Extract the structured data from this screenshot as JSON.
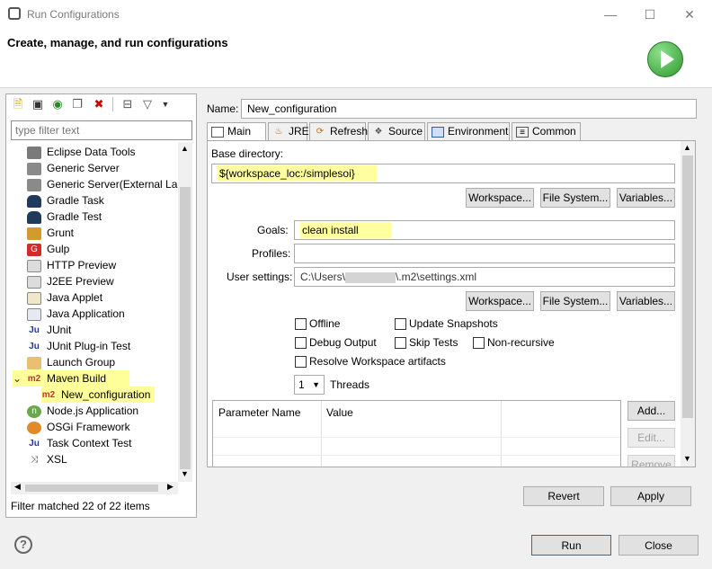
{
  "window": {
    "title": "Run Configurations",
    "minimize_glyph": "—",
    "maximize_glyph": "☐",
    "close_glyph": "✕"
  },
  "header": {
    "subtitle": "Create, manage, and run configurations",
    "run_icon": "run-play-icon"
  },
  "toolbar": {
    "icons": [
      "new-config-icon",
      "new-prototype-icon",
      "export-icon",
      "duplicate-icon",
      "delete-icon",
      "collapse-all-icon",
      "filter-icon",
      "dropdown-icon"
    ]
  },
  "filter": {
    "placeholder": "type filter text"
  },
  "tree": {
    "items": [
      {
        "label": "Eclipse Data Tools",
        "icon": "eclipse-data-tools-icon"
      },
      {
        "label": "Generic Server",
        "icon": "generic-server-icon"
      },
      {
        "label": "Generic Server(External Laur",
        "icon": "generic-server-external-icon"
      },
      {
        "label": "Gradle Task",
        "icon": "gradle-task-icon"
      },
      {
        "label": "Gradle Test",
        "icon": "gradle-test-icon"
      },
      {
        "label": "Grunt",
        "icon": "grunt-icon"
      },
      {
        "label": "Gulp",
        "icon": "gulp-icon"
      },
      {
        "label": "HTTP Preview",
        "icon": "http-preview-icon"
      },
      {
        "label": "J2EE Preview",
        "icon": "j2ee-preview-icon"
      },
      {
        "label": "Java Applet",
        "icon": "java-applet-icon"
      },
      {
        "label": "Java Application",
        "icon": "java-application-icon"
      },
      {
        "label": "JUnit",
        "icon": "junit-icon"
      },
      {
        "label": "JUnit Plug-in Test",
        "icon": "junit-plugin-icon"
      },
      {
        "label": "Launch Group",
        "icon": "launch-group-icon"
      },
      {
        "label": "Maven Build",
        "icon": "maven-icon"
      },
      {
        "label": "New_configuration",
        "icon": "maven-config-icon"
      },
      {
        "label": "Node.js Application",
        "icon": "nodejs-icon"
      },
      {
        "label": "OSGi Framework",
        "icon": "osgi-icon"
      },
      {
        "label": "Task Context Test",
        "icon": "task-context-icon"
      },
      {
        "label": "XSL",
        "icon": "xsl-icon"
      }
    ],
    "maven_icon_text": "m2",
    "expand_glyph": "⌄",
    "status": "Filter matched 22 of 22 items"
  },
  "config": {
    "name_label": "Name:",
    "name_value": "New_configuration",
    "tabs": [
      "Main",
      "JRE",
      "Refresh",
      "Source",
      "Environment",
      "Common"
    ],
    "base_dir_label": "Base directory:",
    "base_dir_value": "${workspace_loc:/simplesoi}",
    "workspace_btn": "Workspace...",
    "filesystem_btn": "File System...",
    "variables_btn": "Variables...",
    "goals_label": "Goals:",
    "goals_value": "clean install",
    "profiles_label": "Profiles:",
    "profiles_value": "",
    "user_settings_label": "User settings:",
    "user_settings_prefix": "C:\\Users\\",
    "user_settings_suffix": "\\.m2\\settings.xml",
    "checkboxes": {
      "offline": "Offline",
      "update_snapshots": "Update Snapshots",
      "debug_output": "Debug Output",
      "skip_tests": "Skip Tests",
      "non_recursive": "Non-recursive",
      "resolve_workspace": "Resolve Workspace artifacts"
    },
    "threads_value": "1",
    "threads_label": "Threads",
    "table_headers": [
      "Parameter Name",
      "Value"
    ],
    "add_btn": "Add...",
    "edit_btn": "Edit...",
    "remove_btn": "Remove"
  },
  "footer": {
    "revert": "Revert",
    "apply": "Apply",
    "run": "Run",
    "close": "Close",
    "help_glyph": "?"
  }
}
